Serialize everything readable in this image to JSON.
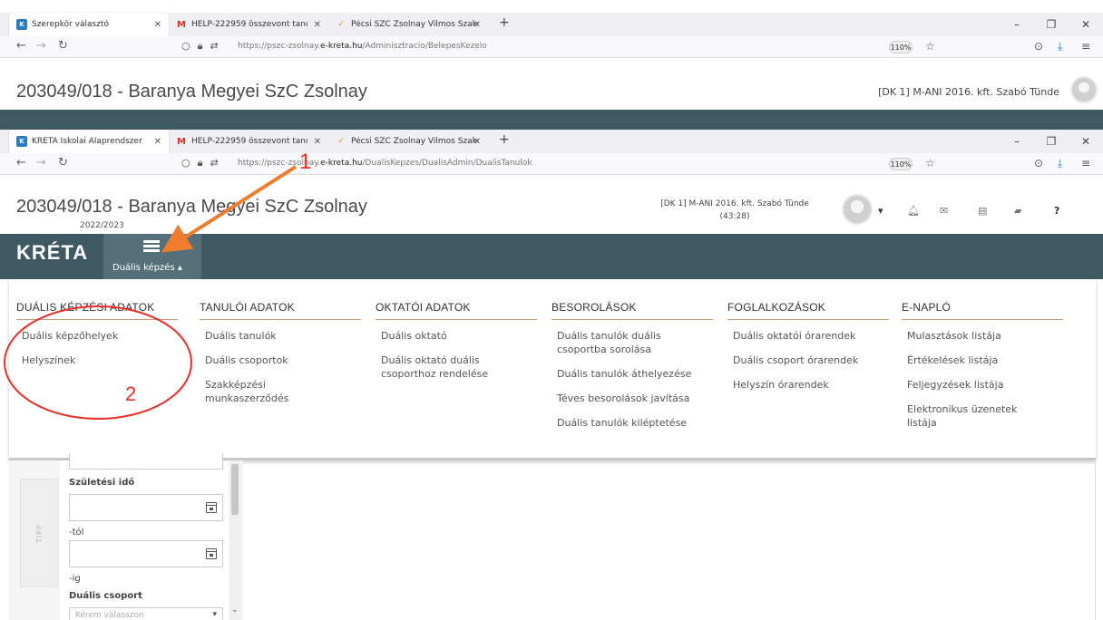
{
  "window1": {
    "tabs": [
      {
        "label": "Szerepkör választó",
        "favicon": "kreta-favicon",
        "active": true
      },
      {
        "label": "HELP-222959 összevont tanórá",
        "favicon": "gmail-icon"
      },
      {
        "label": "Pécsi SZC Zsolnay Vilmos Szakg",
        "favicon": "school-favicon"
      }
    ],
    "url_prefix": "https://pszc-zsolnay.",
    "url_domain": "e-kreta.hu",
    "url_path": "/Adminisztracio/BelepesKezelo",
    "zoom": "110%",
    "page_title": "203049/018 - Baranya Megyei SzC Zsolnay",
    "user": "[DK 1] M-ANI 2016. kft. Szabó Tünde"
  },
  "window2": {
    "tabs": [
      {
        "label": "KRÉTA Iskolai Alaprendszer",
        "favicon": "kreta-favicon",
        "active": true
      },
      {
        "label": "HELP-222959 összevont tanórá",
        "favicon": "gmail-icon"
      },
      {
        "label": "Pécsi SZC Zsolnay Vilmos Szakg",
        "favicon": "school-favicon"
      }
    ],
    "url_prefix": "https://pszc-zsolnay.",
    "url_domain": "e-kreta.hu",
    "url_path": "/DualisKepzes/DualisAdmin/DualisTanulok",
    "zoom": "110%",
    "page_title": "203049/018 - Baranya Megyei SzC Zsolnay",
    "school_year": "2022/2023",
    "user_line1": "[DK 1] M-ANI 2016. kft. Szabó Tünde",
    "user_line2": "(43:28)",
    "logo": "KRÉTA",
    "menu_button": "Duális képzés ▴"
  },
  "mega_menu": {
    "columns": [
      {
        "heading": "DUÁLIS KÉPZÉSI ADATOK",
        "items": [
          "Duális képzőhelyek",
          "Helyszínek"
        ]
      },
      {
        "heading": "TANULÓI ADATOK",
        "items": [
          "Duális tanulók",
          "Duális csoportok",
          "Szakképzési munkaszerződés"
        ]
      },
      {
        "heading": "OKTATÓI ADATOK",
        "items": [
          "Duális oktató",
          "Duális oktató duális csoporthoz rendelése"
        ]
      },
      {
        "heading": "BESOROLÁSOK",
        "items": [
          "Duális tanulók duális csoportba sorolása",
          "Duális tanulók áthelyezése",
          "Téves besorolások javítása",
          "Duális tanulók kiléptetése"
        ]
      },
      {
        "heading": "FOGLALKOZÁSOK",
        "items": [
          "Duális oktatói órarendek",
          "Duális csoport órarendek",
          "Helyszín órarendek"
        ]
      },
      {
        "heading": "E-NAPLÓ",
        "items": [
          "Mulasztások listája",
          "Értékelések listája",
          "Feljegyzések listája",
          "Elektronikus üzenetek listája"
        ]
      }
    ]
  },
  "form": {
    "tipp": "TIPP",
    "birth_label": "Születési idő",
    "from_label": "-tól",
    "to_label": "-ig",
    "group_label": "Duális csoport",
    "group_placeholder": "Kérem válasszon"
  },
  "annotations": {
    "num1": "1",
    "num2": "2",
    "arrow_color": "#ef7d2d",
    "circle_color": "#e8302a"
  },
  "colors": {
    "brand_bar": "#3f5963",
    "active_menu": "#557079"
  }
}
